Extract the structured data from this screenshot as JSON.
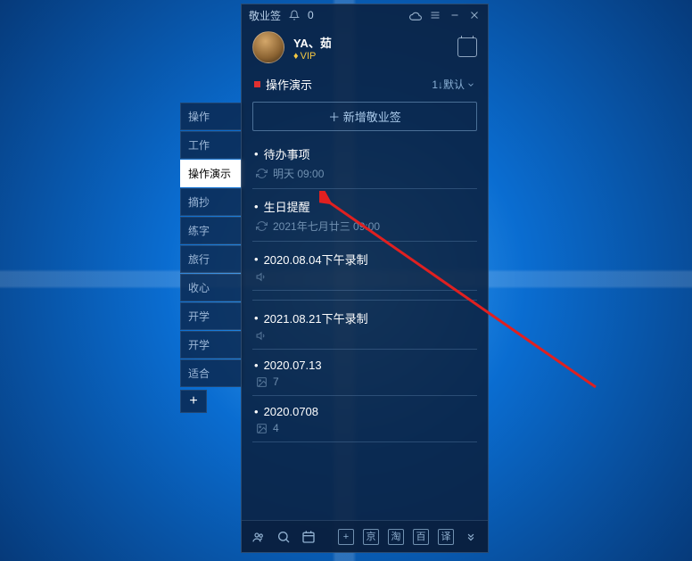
{
  "titlebar": {
    "app_name": "敬业签",
    "notif_count": "0"
  },
  "profile": {
    "name": "YA、茹",
    "vip_label": "VIP"
  },
  "category": {
    "current": "操作演示",
    "sort_label": "1↓默认"
  },
  "add_button": "＋ 新增敬业签",
  "sidebar": {
    "tabs": [
      "操作",
      "工作",
      "操作演示",
      "摘抄",
      "练字",
      "旅行",
      "收心",
      "开学",
      "开学",
      "适合"
    ],
    "active_index": 2,
    "add": "+"
  },
  "notes": [
    {
      "title": "待办事项",
      "meta_icon": "repeat",
      "meta_text": "明天 09:00"
    },
    {
      "title": "生日提醒",
      "meta_icon": "repeat",
      "meta_text": "2021年七月廿三 09:00"
    },
    {
      "title": "2020.08.04下午录制",
      "meta_icon": "sound",
      "meta_text": ""
    },
    {
      "title": "2021.08.21下午录制",
      "meta_icon": "sound",
      "meta_text": "",
      "spaced": true
    },
    {
      "title": "2020.07.13",
      "meta_icon": "image",
      "meta_text": "7"
    },
    {
      "title": "2020.0708",
      "meta_icon": "image",
      "meta_text": "4"
    }
  ],
  "bottom": {
    "sq1": "京",
    "sq2": "淘",
    "sq3": "百",
    "sq4": "译"
  }
}
